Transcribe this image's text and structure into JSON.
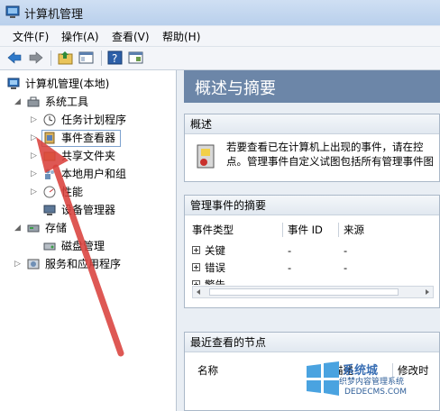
{
  "window": {
    "title": "计算机管理"
  },
  "menu": [
    "文件(F)",
    "操作(A)",
    "查看(V)",
    "帮助(H)"
  ],
  "toolbar": {
    "icons": [
      "back-arrow-icon",
      "forward-arrow-icon",
      "up-folder-icon",
      "show-hide-tree-icon",
      "help-icon",
      "console-icon"
    ]
  },
  "tree": {
    "root": "计算机管理(本地)",
    "system_tools": "系统工具",
    "task_scheduler": "任务计划程序",
    "event_viewer": "事件查看器",
    "shared_folders": "共享文件夹",
    "local_users": "本地用户和组",
    "performance": "性能",
    "device_manager": "设备管理器",
    "storage": "存储",
    "disk_management": "磁盘管理",
    "services_apps": "服务和应用程序"
  },
  "main": {
    "header": "概述与摘要",
    "overview_title": "概述",
    "overview_text": "若要查看已在计算机上出现的事件，请在控点。管理事件自定义试图包括所有管理事件图",
    "summary_title": "管理事件的摘要",
    "summary_columns": [
      "事件类型",
      "事件 ID",
      "来源"
    ],
    "summary_rows": [
      {
        "type": "关键",
        "id": "-",
        "source": "-"
      },
      {
        "type": "错误",
        "id": "-",
        "source": "-"
      },
      {
        "type": "警告",
        "id": "",
        "source": ""
      }
    ],
    "recent_title": "最近查看的节点",
    "recent_columns": [
      "名称",
      "描述",
      "修改时"
    ]
  },
  "watermark": {
    "line1": "系统城",
    "line2": "织梦内容管理系统",
    "line3": "DEDECMS.COM"
  }
}
